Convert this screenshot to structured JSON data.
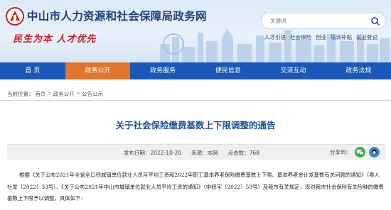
{
  "header": {
    "site_title": "中山市人力资源和社会保障局政务网",
    "slogan": "民生为本  人才优先",
    "search_placeholder": "关键词",
    "hot_links": [
      "人才引进",
      "社会保险",
      "创业",
      "培训补贴",
      "就业登记"
    ]
  },
  "nav": {
    "items": [
      {
        "label": "首  页",
        "active": false
      },
      {
        "label": "政务公开",
        "active": true
      },
      {
        "label": "政务服务",
        "active": false
      },
      {
        "label": "便民信息",
        "active": false
      },
      {
        "label": "交流互动",
        "active": false
      },
      {
        "label": "政务法规",
        "active": false
      }
    ]
  },
  "breadcrumb": {
    "prefix": "当前位置：",
    "items": [
      "首页",
      "政务公开",
      "公告公示"
    ],
    "separator": ">"
  },
  "article": {
    "title": "关于社会保险缴费基数上下限调整的通告",
    "publish_date": "发布日期：2022-10-20",
    "source": "来源：本网",
    "views": "点击数：768",
    "share_label": "分享到：",
    "body": "根据《关于公布2021年全省全口径城镇单位就业人员月平均工资和2022年职工基本养老保险缴费基数上下限、基本养老金计发基数有关问题的通知》（粤人社发〔2022〕33号）、《关于公布2021年中山市城镇单位就业人员平均工资的通知》（中统字〔2022〕59号）及我市有关规定，现对我市社会保险有关险种的缴费基数上下限予以调整，具体如下："
  },
  "colors": {
    "nav_bg": "#1a58b8",
    "nav_active": "#e2742b",
    "title_blue": "#1a4f9c",
    "slogan_red": "#c8201f"
  }
}
